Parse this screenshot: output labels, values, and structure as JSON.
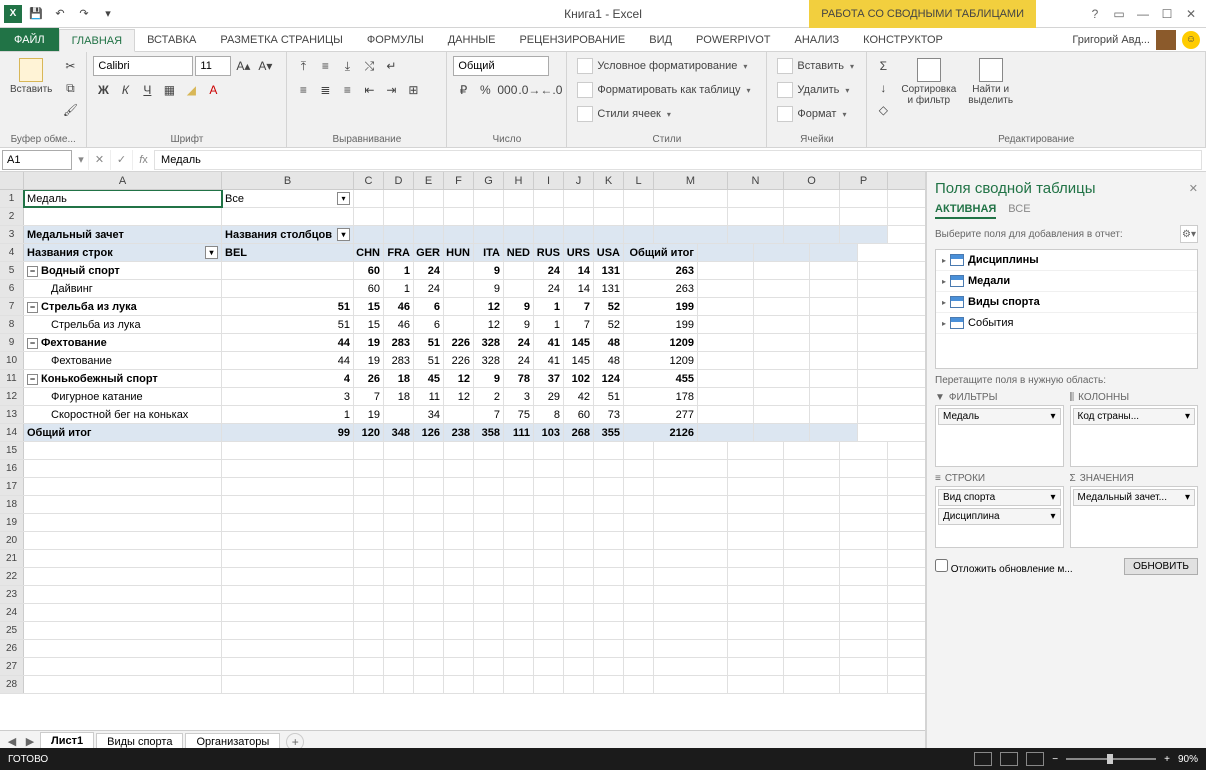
{
  "title": "Книга1 - Excel",
  "context_tab": "РАБОТА СО СВОДНЫМИ ТАБЛИЦАМИ",
  "user_name": "Григорий Авд...",
  "tabs": {
    "file": "ФАЙЛ",
    "home": "ГЛАВНАЯ",
    "insert": "ВСТАВКА",
    "layout": "РАЗМЕТКА СТРАНИЦЫ",
    "formulas": "ФОРМУЛЫ",
    "data": "ДАННЫЕ",
    "review": "РЕЦЕНЗИРОВАНИЕ",
    "view": "ВИД",
    "powerpivot": "POWERPIVOT",
    "analyze": "АНАЛИЗ",
    "design": "КОНСТРУКТОР"
  },
  "ribbon": {
    "clipboard": {
      "paste": "Вставить",
      "label": "Буфер обме..."
    },
    "font": {
      "name": "Calibri",
      "size": "11",
      "bold": "Ж",
      "italic": "К",
      "underline": "Ч",
      "label": "Шрифт"
    },
    "alignment": {
      "label": "Выравнивание"
    },
    "number": {
      "format": "Общий",
      "label": "Число"
    },
    "styles": {
      "cond": "Условное форматирование",
      "table": "Форматировать как таблицу",
      "cell_styles": "Стили ячеек",
      "label": "Стили"
    },
    "cells": {
      "insert": "Вставить",
      "delete": "Удалить",
      "format": "Формат",
      "label": "Ячейки"
    },
    "editing": {
      "sort": "Сортировка\nи фильтр",
      "find": "Найти и\nвыделить",
      "label": "Редактирование"
    }
  },
  "name_box": "A1",
  "formula_value": "Медаль",
  "columns": [
    "A",
    "B",
    "C",
    "D",
    "E",
    "F",
    "G",
    "H",
    "I",
    "J",
    "K",
    "L",
    "M",
    "N",
    "O",
    "P"
  ],
  "pivot": {
    "filter_field": "Медаль",
    "filter_value": "Все",
    "row_label": "Названия строк",
    "col_label": "Названия столбцов",
    "report_header": "Медальный зачет",
    "grand_row": "Общий итог",
    "grand_col": "Общий итог",
    "col_vals": [
      "BEL",
      "CHN",
      "FRA",
      "GER",
      "HUN",
      "ITA",
      "NED",
      "RUS",
      "URS",
      "USA"
    ],
    "rows": [
      {
        "n": 5,
        "label": "Водный спорт",
        "exp": "-",
        "indent": 0,
        "bold": true,
        "vals": [
          "",
          "60",
          "1",
          "24",
          "",
          "9",
          "",
          "24",
          "14",
          "131",
          "263"
        ]
      },
      {
        "n": 6,
        "label": "Дайвинг",
        "indent": 2,
        "vals": [
          "",
          "60",
          "1",
          "24",
          "",
          "9",
          "",
          "24",
          "14",
          "131",
          "263"
        ]
      },
      {
        "n": 7,
        "label": "Стрельба из лука",
        "exp": "-",
        "indent": 0,
        "bold": true,
        "vals": [
          "51",
          "15",
          "46",
          "6",
          "",
          "12",
          "9",
          "1",
          "7",
          "52",
          "199"
        ]
      },
      {
        "n": 8,
        "label": "Стрельба из лука",
        "indent": 2,
        "vals": [
          "51",
          "15",
          "46",
          "6",
          "",
          "12",
          "9",
          "1",
          "7",
          "52",
          "199"
        ]
      },
      {
        "n": 9,
        "label": "Фехтование",
        "exp": "-",
        "indent": 0,
        "bold": true,
        "vals": [
          "44",
          "19",
          "283",
          "51",
          "226",
          "328",
          "24",
          "41",
          "145",
          "48",
          "1209"
        ]
      },
      {
        "n": 10,
        "label": "Фехтование",
        "indent": 2,
        "vals": [
          "44",
          "19",
          "283",
          "51",
          "226",
          "328",
          "24",
          "41",
          "145",
          "48",
          "1209"
        ]
      },
      {
        "n": 11,
        "label": "Конькобежный спорт",
        "exp": "-",
        "indent": 0,
        "bold": true,
        "vals": [
          "4",
          "26",
          "18",
          "45",
          "12",
          "9",
          "78",
          "37",
          "102",
          "124",
          "455"
        ]
      },
      {
        "n": 12,
        "label": "Фигурное катание",
        "indent": 2,
        "vals": [
          "3",
          "7",
          "18",
          "11",
          "12",
          "2",
          "3",
          "29",
          "42",
          "51",
          "178"
        ]
      },
      {
        "n": 13,
        "label": "Скоростной бег на коньках",
        "indent": 2,
        "vals": [
          "1",
          "19",
          "",
          "34",
          "",
          "7",
          "75",
          "8",
          "60",
          "73",
          "277"
        ]
      }
    ],
    "grand_vals": [
      "99",
      "120",
      "348",
      "126",
      "238",
      "358",
      "111",
      "103",
      "268",
      "355",
      "2126"
    ]
  },
  "sheets": {
    "s1": "Лист1",
    "s2": "Виды спорта",
    "s3": "Организаторы"
  },
  "field_pane": {
    "title": "Поля сводной таблицы",
    "tab_active": "АКТИВНАЯ",
    "tab_all": "ВСЕ",
    "desc": "Выберите поля для добавления в отчет:",
    "tables": [
      "Дисциплины",
      "Медали",
      "Виды спорта",
      "События"
    ],
    "drag_hint": "Перетащите поля в нужную область:",
    "zones": {
      "filters": "ФИЛЬТРЫ",
      "columns": "КОЛОННЫ",
      "rows": "СТРОКИ",
      "values": "ЗНАЧЕНИЯ"
    },
    "filter_item": "Медаль",
    "column_item": "Код страны...",
    "row_items": [
      "Вид спорта",
      "Дисциплина"
    ],
    "value_item": "Медальный зачет...",
    "defer": "Отложить обновление м...",
    "update": "ОБНОВИТЬ"
  },
  "status": {
    "ready": "ГОТОВО",
    "zoom": "90%"
  }
}
